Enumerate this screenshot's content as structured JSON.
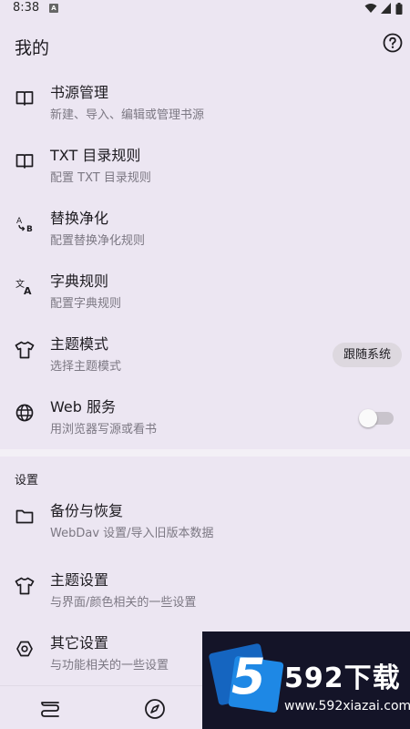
{
  "status_bar": {
    "time": "8:38",
    "notif_icon": "A"
  },
  "header": {
    "title": "我的",
    "help_icon": "help-circle-icon"
  },
  "menu_items": [
    {
      "title": "书源管理",
      "subtitle": "新建、导入、编辑或管理书源",
      "icon": "book-open-icon"
    },
    {
      "title": "TXT 目录规则",
      "subtitle": "配置 TXT 目录规则",
      "icon": "book-open-icon"
    },
    {
      "title": "替换净化",
      "subtitle": "配置替换净化规则",
      "icon": "replace-icon"
    },
    {
      "title": "字典规则",
      "subtitle": "配置字典规则",
      "icon": "translate-icon"
    },
    {
      "title": "主题模式",
      "subtitle": "选择主题模式",
      "icon": "shirt-icon",
      "value": "跟随系统"
    },
    {
      "title": "Web 服务",
      "subtitle": "用浏览器写源或看书",
      "icon": "globe-icon",
      "toggle_on": false
    }
  ],
  "settings_section": {
    "label": "设置",
    "items": [
      {
        "title": "备份与恢复",
        "subtitle": "WebDav 设置/导入旧版本数据",
        "icon": "folder-icon"
      },
      {
        "title": "主题设置",
        "subtitle": "与界面/颜色相关的一些设置",
        "icon": "shirt-icon"
      },
      {
        "title": "其它设置",
        "subtitle": "与功能相关的一些设置",
        "icon": "settings-hex-icon"
      }
    ]
  },
  "bottom_nav": [
    {
      "icon": "bookshelf-icon"
    },
    {
      "icon": "compass-icon"
    }
  ],
  "watermark": {
    "logo_number": "5",
    "brand": "592下载",
    "url": "www.592xiazai.com"
  }
}
